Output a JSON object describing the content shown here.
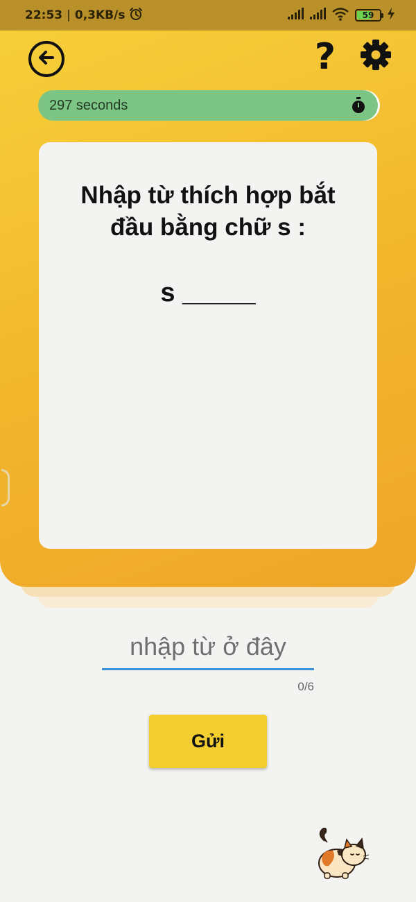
{
  "status_bar": {
    "time": "22:53",
    "separator": "|",
    "network_speed": "0,3KB/s",
    "battery_level": "59",
    "icons": [
      "alarm-icon",
      "signal-icon",
      "signal-icon",
      "wifi-icon",
      "battery-icon",
      "charging-icon"
    ]
  },
  "header": {
    "back_icon": "arrow-left-circle-icon",
    "help_label": "?",
    "settings_icon": "gear-icon"
  },
  "timer": {
    "text": "297 seconds",
    "icon": "stopwatch-icon"
  },
  "question": {
    "prompt": "Nhập từ thích hợp bắt đầu bằng chữ s :",
    "word_pattern": "s _____"
  },
  "answer": {
    "value": "",
    "placeholder": "nhập từ ở đây",
    "counter": "0/6"
  },
  "submit": {
    "label": "Gửi"
  },
  "colors": {
    "panel_yellow": "#f2b52c",
    "timer_green": "#7dc584",
    "button_yellow": "#f2ce30",
    "input_underline": "#3a8fd6",
    "background": "#f3f4f2"
  },
  "mascot_icon": "calico-cat-icon"
}
